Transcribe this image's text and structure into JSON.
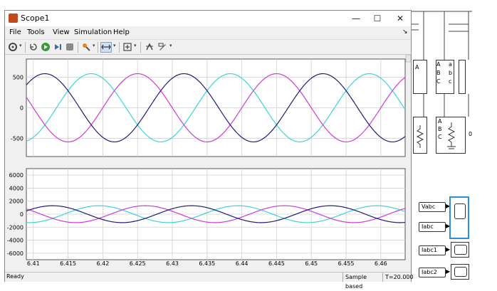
{
  "window": {
    "title": "Scope1",
    "minimize": "—",
    "maximize": "☐",
    "close": "✕"
  },
  "menu": [
    "File",
    "Tools",
    "View",
    "Simulation",
    "Help"
  ],
  "menu_expand": "↘",
  "toolbar_icons": [
    "gear-icon",
    "restore-icon",
    "run-icon",
    "step-forward-icon",
    "stop-icon",
    "highlight-icon",
    "zoom-icon",
    "fit-icon",
    "cursor-icon",
    "style-icon"
  ],
  "status": {
    "ready": "Ready",
    "mode": "Sample based",
    "time": "T=20.000"
  },
  "colors": {
    "phase_a": "#3cd3db",
    "phase_b": "#d13ad8",
    "phase_c": "#1e1e7a",
    "plot_bg": "#ffffff",
    "grid": "#d0d0d0"
  },
  "chart_data": [
    {
      "type": "line",
      "x_ticks": [
        "6.41",
        "6.415",
        "6.42",
        "6.425",
        "6.43",
        "6.435",
        "6.44",
        "6.445",
        "6.45",
        "6.455",
        "6.46"
      ],
      "xlim": [
        6.409,
        6.4635
      ],
      "y_ticks": [
        "500",
        "0",
        "-500"
      ],
      "ylim": [
        -800,
        800
      ],
      "amplitude": 560,
      "frequency_hz": 50,
      "series": [
        {
          "phase_deg": 120,
          "color": "#3cd3db"
        },
        {
          "phase_deg": 0,
          "color": "#d13ad8"
        },
        {
          "phase_deg": -120,
          "color": "#1e1e7a"
        }
      ]
    },
    {
      "type": "line",
      "x_ticks": [
        "6.41",
        "6.415",
        "6.42",
        "6.425",
        "6.43",
        "6.435",
        "6.44",
        "6.445",
        "6.45",
        "6.455",
        "6.46"
      ],
      "xlim": [
        6.409,
        6.4635
      ],
      "y_ticks": [
        "6000",
        "4000",
        "2000",
        "0",
        "-2000",
        "-4000",
        "-6000"
      ],
      "ylim": [
        -7000,
        7000
      ],
      "amplitude": 1300,
      "frequency_hz": 50,
      "series": [
        {
          "phase_deg": 100,
          "color": "#3cd3db"
        },
        {
          "phase_deg": -20,
          "color": "#d13ad8"
        },
        {
          "phase_deg": -140,
          "color": "#1e1e7a"
        }
      ]
    }
  ],
  "simulink": {
    "block_ports": [
      "A",
      "B",
      "C",
      "a",
      "b",
      "c"
    ],
    "side_label": "0",
    "tags": [
      "Vabc",
      "Iabc",
      "Iabc1",
      "Iabc2"
    ]
  }
}
